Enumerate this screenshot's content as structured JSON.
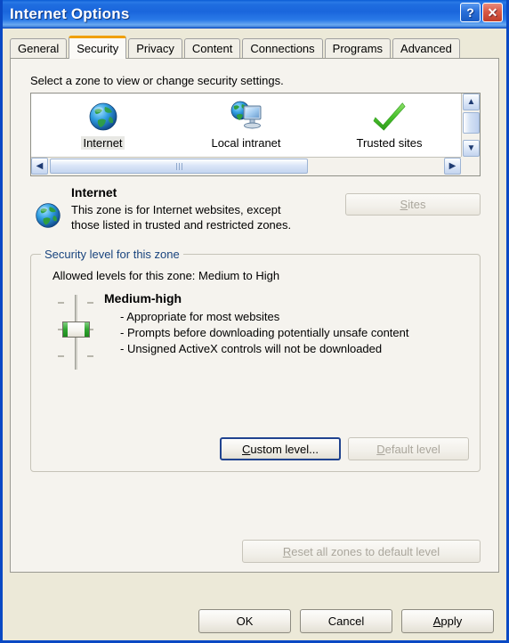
{
  "window": {
    "title": "Internet Options",
    "help_button": "?",
    "close_button": "✕"
  },
  "tabs": [
    {
      "label": "General",
      "active": false
    },
    {
      "label": "Security",
      "active": true
    },
    {
      "label": "Privacy",
      "active": false
    },
    {
      "label": "Content",
      "active": false
    },
    {
      "label": "Connections",
      "active": false
    },
    {
      "label": "Programs",
      "active": false
    },
    {
      "label": "Advanced",
      "active": false
    }
  ],
  "security": {
    "hint": "Select a zone to view or change security settings.",
    "zones": [
      {
        "label": "Internet",
        "icon": "globe-icon",
        "selected": true
      },
      {
        "label": "Local intranet",
        "icon": "intranet-icon",
        "selected": false
      },
      {
        "label": "Trusted sites",
        "icon": "green-check-icon",
        "selected": false
      }
    ],
    "description": {
      "title": "Internet",
      "body": "This zone is for Internet websites, except those listed in trusted and restricted zones."
    },
    "sites_button": {
      "label": "Sites",
      "accel": "S",
      "disabled": true
    },
    "group": {
      "title": "Security level for this zone",
      "allowed_levels": "Allowed levels for this zone: Medium to High",
      "level_name": "Medium-high",
      "bullets": [
        "- Appropriate for most websites",
        "- Prompts before downloading potentially unsafe content",
        "- Unsigned ActiveX controls will not be downloaded"
      ],
      "custom_button": {
        "label": "Custom level...",
        "accel": "C",
        "focused": true
      },
      "default_button": {
        "label": "Default level",
        "accel": "D",
        "disabled": true
      }
    },
    "reset_button": {
      "label": "Reset all zones to default level",
      "accel": "R",
      "disabled": true
    }
  },
  "footer": {
    "ok": "OK",
    "cancel": "Cancel",
    "apply": "Apply",
    "apply_accel": "A"
  },
  "colors": {
    "titlebar_blue": "#1a66dc",
    "active_tab_accent": "#f0a000",
    "group_title": "#19447e",
    "slider_green": "#2fa52f",
    "dialog_bg": "#ece9d8",
    "panel_bg": "#f5f3ee"
  }
}
